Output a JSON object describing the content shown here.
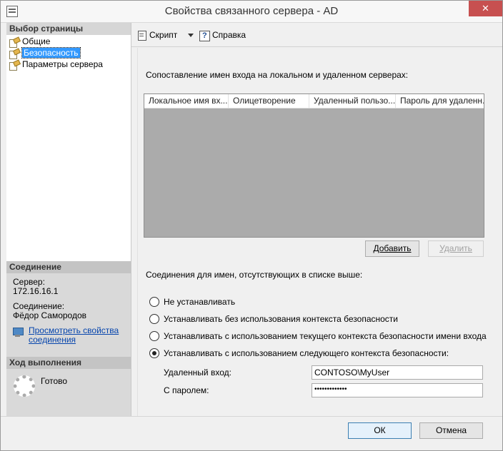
{
  "window": {
    "title": "Свойства связанного сервера - AD",
    "close_label": "✕"
  },
  "sidebar": {
    "select_page_header": "Выбор страницы",
    "pages": [
      {
        "label": "Общие",
        "selected": false
      },
      {
        "label": "Безопасность",
        "selected": true
      },
      {
        "label": "Параметры сервера",
        "selected": false
      }
    ],
    "connection_header": "Соединение",
    "server_label": "Сервер:",
    "server_value": "172.16.16.1",
    "connection_label": "Соединение:",
    "connection_value": "Фёдор Самородов",
    "view_properties_link": "Просмотреть свойства соединения",
    "progress_header": "Ход выполнения",
    "progress_status": "Готово"
  },
  "toolbar": {
    "script_label": "Скрипт",
    "help_label": "Справка"
  },
  "security": {
    "mapping_caption": "Сопоставление имен входа на локальном и удаленном серверах:",
    "grid_columns": [
      "Локальное имя вх...",
      "Олицетворение",
      "Удаленный пользо...",
      "Пароль для удаленн..."
    ],
    "add_button": "Добавить",
    "remove_button": "Удалить",
    "unmapped_caption": "Соединения для имен, отсутствующих в списке выше:",
    "options": [
      {
        "label": "Не устанавливать",
        "checked": false
      },
      {
        "label": "Устанавливать без использования контекста безопасности",
        "checked": false
      },
      {
        "label": "Устанавливать с использованием текущего контекста безопасности имени входа",
        "checked": false
      },
      {
        "label": "Устанавливать с использованием следующего контекста безопасности:",
        "checked": true
      }
    ],
    "remote_login_label": "Удаленный вход:",
    "remote_login_value": "CONTOSO\\MyUser",
    "password_label": "С паролем:",
    "password_value": "•••••••••••••"
  },
  "footer": {
    "ok_button": "ОК",
    "cancel_button": "Отмена"
  }
}
